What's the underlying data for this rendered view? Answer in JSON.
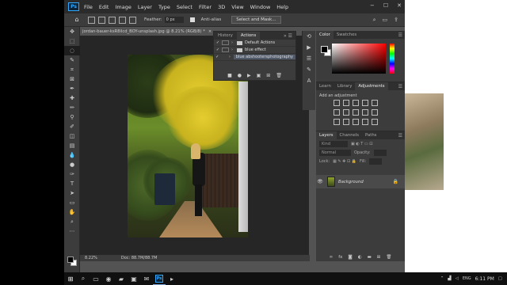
{
  "app": {
    "logo_text": "Ps",
    "menus": [
      "File",
      "Edit",
      "Image",
      "Layer",
      "Type",
      "Select",
      "Filter",
      "3D",
      "View",
      "Window",
      "Help"
    ],
    "window_controls": [
      "−",
      "☐",
      "✕"
    ]
  },
  "options_bar": {
    "feather_label": "Feather:",
    "feather_value": "0 px",
    "antialias_label": "Anti-alias",
    "select_mask_button": "Select and Mask..."
  },
  "document": {
    "tab_title": "jordan-bauer-ksR8ilcd_BOY-unsplash.jpg @ 8.21% (RGB/8) *",
    "close_glyph": "×",
    "zoom_level": "8.22%",
    "doc_size": "Doc: 88.7M/88.7M"
  },
  "actions_panel": {
    "tabs": [
      "History",
      "Actions"
    ],
    "active_tab": "Actions",
    "rows": [
      {
        "label": "Default Actions",
        "checked": true
      },
      {
        "label": "blue effect",
        "checked": true
      },
      {
        "label": "blue abshootersphotography",
        "checked": true,
        "selected": true
      }
    ]
  },
  "color_panel": {
    "tabs": [
      "Color",
      "Swatches"
    ],
    "active_tab": "Color",
    "foreground": "#000000",
    "background": "#ffffff",
    "hue_color": "#ff0000"
  },
  "adjustments_panel": {
    "tabs": [
      "Learn",
      "Library",
      "Adjustments"
    ],
    "active_tab": "Adjustments",
    "hint": "Add an adjustment"
  },
  "layers_panel": {
    "tabs": [
      "Layers",
      "Channels",
      "Paths"
    ],
    "active_tab": "Layers",
    "kind_placeholder": "Kind",
    "blend_mode": "Normal",
    "opacity_label": "Opacity:",
    "lock_label": "Lock:",
    "fill_label": "Fill:",
    "layer_name": "Background"
  },
  "taskbar": {
    "time": "6:11 PM",
    "lang": "ENG"
  }
}
